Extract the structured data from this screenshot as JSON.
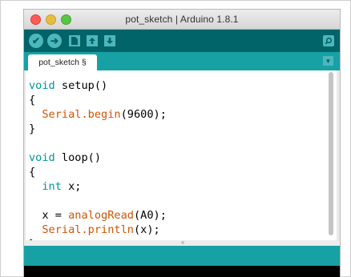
{
  "window": {
    "title": "pot_sketch | Arduino 1.8.1"
  },
  "toolbar": {
    "verify_icon": "check-icon",
    "upload_icon": "arrow-right-icon",
    "new_icon": "document-icon",
    "open_icon": "arrow-up-icon",
    "save_icon": "arrow-down-icon",
    "serial_icon": "magnifier-icon"
  },
  "tabs": [
    {
      "label": "pot_sketch §"
    }
  ],
  "editor": {
    "lines": [
      {
        "keyword": "void",
        "rest": " setup()"
      },
      {
        "text": "{"
      },
      {
        "indent": "  ",
        "call": "Serial.begin",
        "rest": "(9600);"
      },
      {
        "text": "}"
      },
      {
        "text": ""
      },
      {
        "keyword": "void",
        "rest": " loop()"
      },
      {
        "text": "{"
      },
      {
        "indent": "  ",
        "keyword": "int",
        "rest": " x;"
      },
      {
        "text": ""
      },
      {
        "prefix": "  x = ",
        "call": "analogRead",
        "rest": "(A0);"
      },
      {
        "indent": "  ",
        "call": "Serial.println",
        "rest": "(x);"
      },
      {
        "text": "}"
      }
    ]
  },
  "colors": {
    "toolbar": "#006468",
    "accent": "#17a1a5",
    "button": "#4db7bb",
    "keyword": "#00979c",
    "function": "#d35400"
  }
}
